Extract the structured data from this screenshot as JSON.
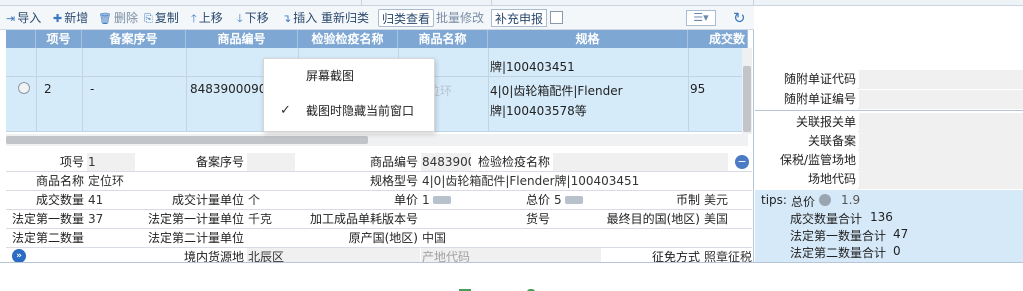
{
  "toolbar": {
    "import": "导入",
    "add": "新增",
    "delete": "删除",
    "copy": "复制",
    "move_up": "上移",
    "move_down": "下移",
    "insert": "插入",
    "reclassify": "重新归类",
    "classify_view": "归类查看",
    "batch_edit": "批量修改",
    "supplement_declare": "补充申报"
  },
  "grid": {
    "headers": [
      "项号",
      "备案序号",
      "商品编号",
      "检验检疫名称",
      "商品名称",
      "规格",
      "成交数"
    ],
    "row1": {
      "spec_line2": "牌|100403451"
    },
    "row2": {
      "item_no": "2",
      "record_no": "-",
      "goods_code": "8483900090",
      "goods_name": "定位环",
      "spec_line1": "4|0|齿轮箱配件|Flender",
      "spec_line2": "牌|100403578等",
      "qty": "95"
    }
  },
  "context_menu": {
    "items": [
      {
        "label": "屏幕截图",
        "checked": false
      },
      {
        "label": "截图时隐藏当前窗口",
        "checked": true
      }
    ]
  },
  "form": {
    "item_no_label": "项号",
    "item_no": "1",
    "record_no_label": "备案序号",
    "goods_code_label": "商品编号",
    "goods_code": "8483900",
    "inspection_name_label": "检验检疫名称",
    "goods_name_label": "商品名称",
    "goods_name": "定位环",
    "spec_label": "规格型号",
    "spec": "4|0|齿轮箱配件|Flender牌|100403451",
    "deal_qty_label": "成交数量",
    "deal_qty": "41",
    "deal_unit_label": "成交计量单位",
    "deal_unit": "个",
    "unit_price_label": "单价",
    "unit_price": "1",
    "total_price_label": "总价",
    "total_price": "5",
    "currency_label": "币制",
    "currency": "美元",
    "legal_qty1_label": "法定第一数量",
    "legal_qty1": "37",
    "legal_unit1_label": "法定第一计量单位",
    "legal_unit1": "千克",
    "processed_version_label": "加工成品单耗版本号",
    "cargo_no_label": "货号",
    "dest_country_label": "最终目的国(地区)",
    "dest_country": "美国",
    "legal_qty2_label": "法定第二数量",
    "legal_unit2_label": "法定第二计量单位",
    "origin_label": "原产国(地区)",
    "origin": "中国",
    "domestic_source_label": "境内货源地",
    "domestic_source": "北辰区",
    "origin_code_placeholder": "产地代码",
    "exemption_label": "征免方式",
    "exemption": "照章征税"
  },
  "right_panel": {
    "doc_code_label": "随附单证代码",
    "doc_no_label": "随附单证编号",
    "related_decl_label": "关联报关单",
    "related_record_label": "关联备案",
    "bonded_site_label": "保税/监管场地",
    "site_code_label": "场地代码",
    "tips": {
      "prefix": "tips:",
      "total_price_label": "总价",
      "total_price_tail": "1.9",
      "deal_qty_total_label": "成交数量合计",
      "deal_qty_total": "136",
      "legal_qty1_total_label": "法定第一数量合计",
      "legal_qty1_total": "47",
      "legal_qty2_total_label": "法定第二数量合计",
      "legal_qty2_total": "0"
    }
  },
  "colors": {
    "header_bg": "#7ea7d4",
    "row_selected_bg": "#d5ebfa",
    "tips_bg": "#d6e9f8",
    "accent": "#3a78c0"
  }
}
